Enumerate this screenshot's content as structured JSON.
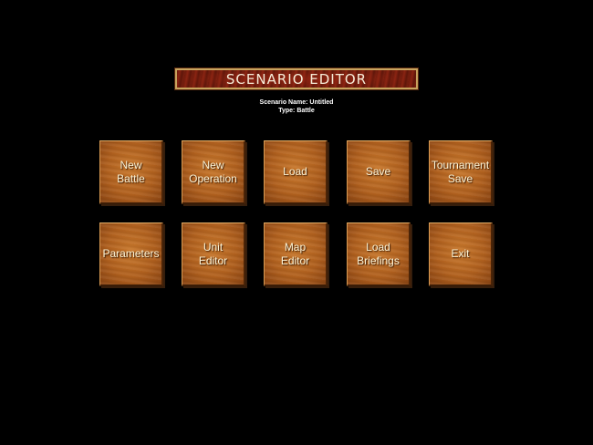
{
  "title": "SCENARIO EDITOR",
  "scenario": {
    "name_line": "Scenario Name: Untitled",
    "type_line": "Type: Battle"
  },
  "buttons": {
    "new_battle": "New\nBattle",
    "new_operation": "New\nOperation",
    "load": "Load",
    "save": "Save",
    "tournament_save": "Tournament\nSave",
    "parameters": "Parameters",
    "unit_editor": "Unit\nEditor",
    "map_editor": "Map\nEditor",
    "load_briefings": "Load\nBriefings",
    "exit": "Exit"
  }
}
